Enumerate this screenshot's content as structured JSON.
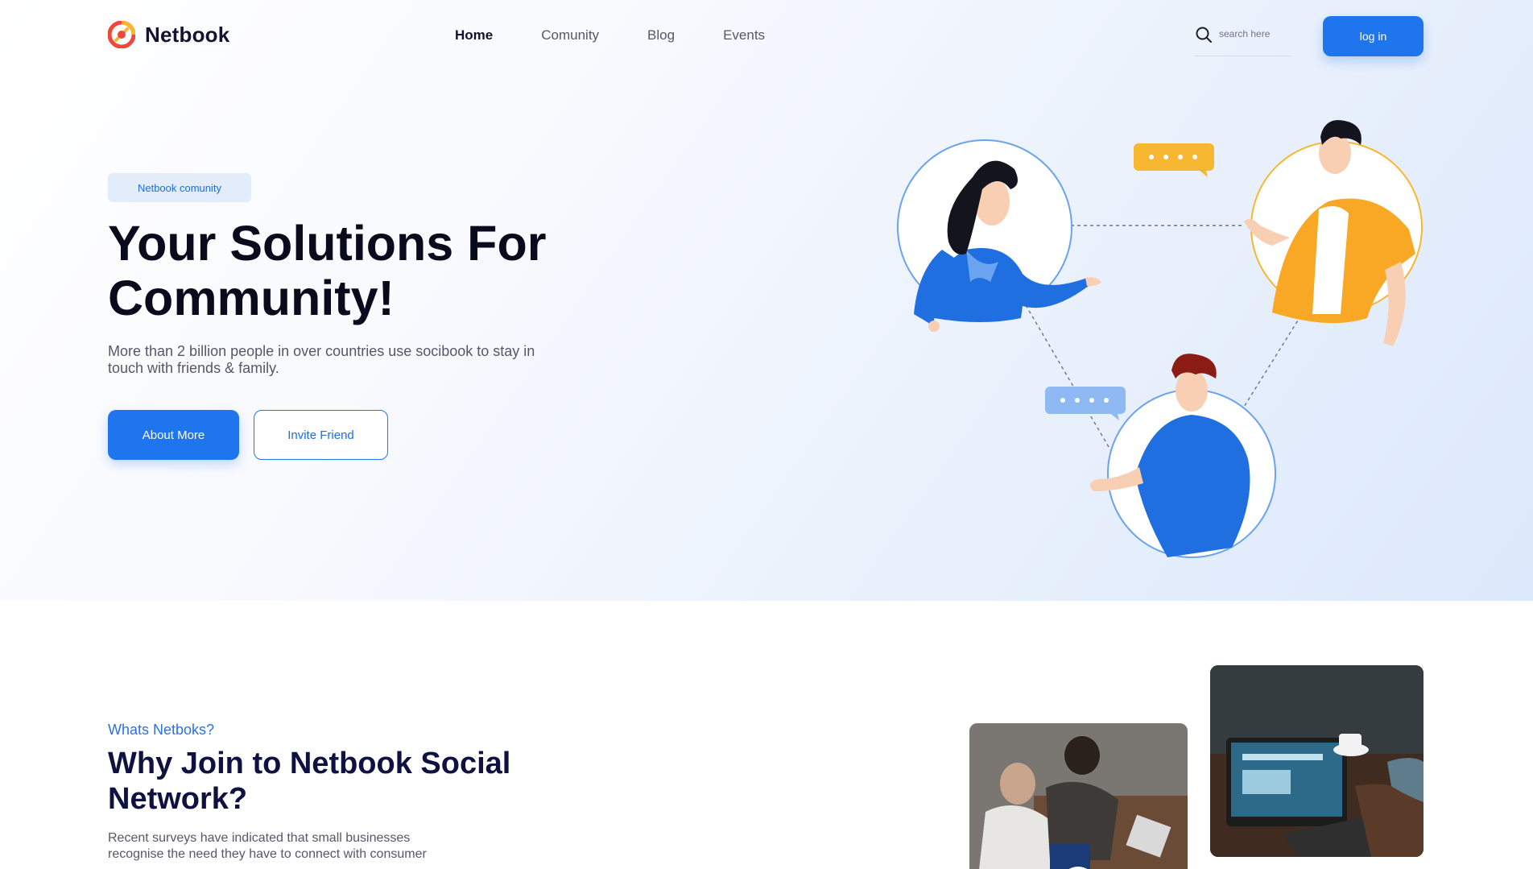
{
  "brand": {
    "name": "Netbook",
    "accent": "#1f75ee",
    "dark": "#090a1c"
  },
  "nav": {
    "items": [
      {
        "label": "Home",
        "active": true
      },
      {
        "label": "Comunity",
        "active": false
      },
      {
        "label": "Blog",
        "active": false
      },
      {
        "label": "Events",
        "active": false
      }
    ]
  },
  "search": {
    "placeholder": "search here",
    "icon": "search-icon"
  },
  "header": {
    "login_label": "log in"
  },
  "hero": {
    "badge": "Netbook comunity",
    "title": "Your Solutions For Community!",
    "subtitle": "More than 2 billion people in over countries use socibook to stay in touch with friends & family.",
    "primary_button": "About More",
    "secondary_button": "Invite Friend"
  },
  "about": {
    "eyebrow": "Whats Netboks?",
    "title": "Why Join to Netbook Social Network?",
    "body": "Recent surveys have indicated that small businesses recognise the need they have to connect with consumer"
  },
  "media": {
    "photo_1": "team-meeting-photo",
    "photo_2": "laptop-coffee-photo",
    "play_icon": "play-icon"
  }
}
